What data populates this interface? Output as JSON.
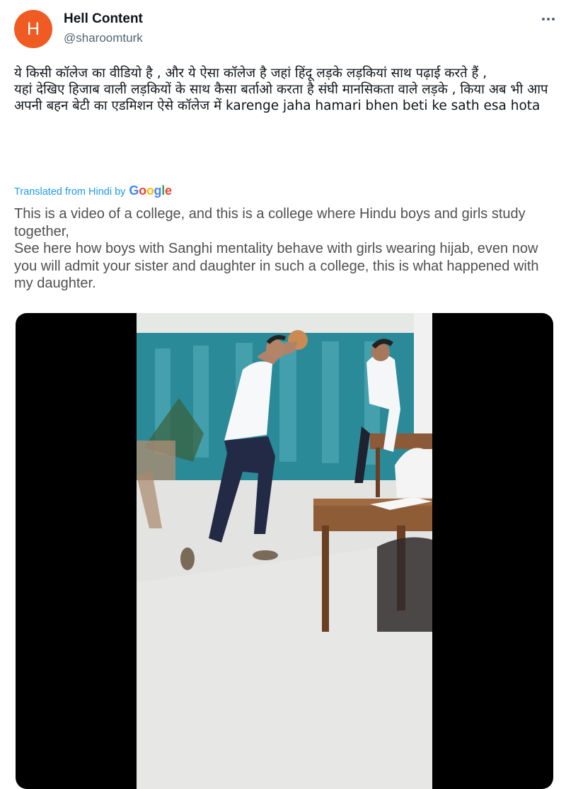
{
  "author": {
    "avatar_letter": "H",
    "avatar_color": "#ef5b22",
    "name": "Hell Content",
    "handle": "@sharoomturk"
  },
  "menu": {
    "icon": "more-horizontal-icon"
  },
  "tweet": {
    "original_lines": [
      "ये किसी कॉलेज का वीडियो है , और ये ऐसा कॉलेज है जहां हिंदू लड़के लड़कियां साथ पढ़ाई करते हैं ,",
      "यहां देखिए हिजाब वाली लड़कियों के साथ कैसा बर्ताओ करता है संघी मानसिकता वाले लड़के , किया अब भी आप अपनी बहन बेटी का एडमिशन ऐसे कॉलेज में karenge jaha hamari bhen beti ke sath esa hota"
    ],
    "translation_label": "Translated from Hindi by",
    "translation_provider": "Google",
    "translated_lines": [
      "This is a video of a college, and this is a college where Hindu boys and girls study together,",
      "See here how boys with Sanghi mentality behave with girls wearing hijab, even now you will admit your sister and daughter in such a college, this is what happened with my daughter."
    ]
  },
  "colors": {
    "link_blue": "#1d9bf0",
    "secondary_text": "#536471",
    "google_blue": "#4285f4",
    "google_red": "#ea4335",
    "google_yellow": "#fbbc05",
    "google_green": "#34a853"
  }
}
